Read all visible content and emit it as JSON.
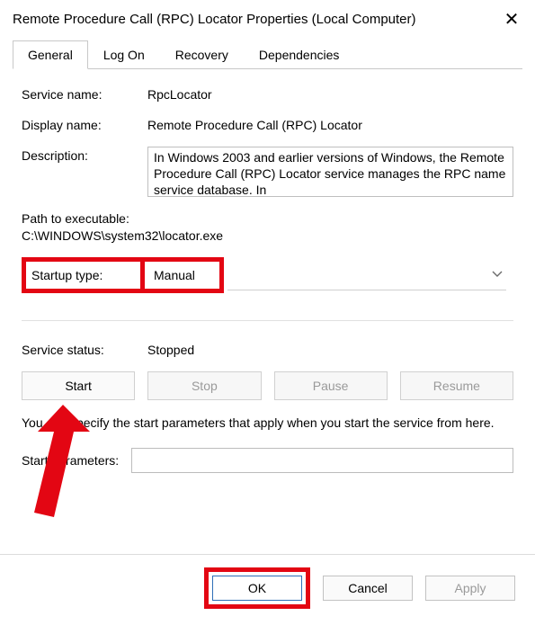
{
  "title": "Remote Procedure Call (RPC) Locator Properties (Local Computer)",
  "tabs": {
    "general": "General",
    "logon": "Log On",
    "recovery": "Recovery",
    "dependencies": "Dependencies"
  },
  "labels": {
    "service_name": "Service name:",
    "display_name": "Display name:",
    "description": "Description:",
    "path_to_exe": "Path to executable:",
    "startup_type": "Startup type:",
    "service_status": "Service status:",
    "start_params": "Start parameters:"
  },
  "values": {
    "service_name": "RpcLocator",
    "display_name": "Remote Procedure Call (RPC) Locator",
    "description": "In Windows 2003 and earlier versions of Windows, the Remote Procedure Call (RPC) Locator service manages the RPC name service database. In",
    "path": "C:\\WINDOWS\\system32\\locator.exe",
    "startup_type": "Manual",
    "service_status": "Stopped",
    "start_params": ""
  },
  "buttons": {
    "start": "Start",
    "stop": "Stop",
    "pause": "Pause",
    "resume": "Resume",
    "ok": "OK",
    "cancel": "Cancel",
    "apply": "Apply"
  },
  "hint": "You can specify the start parameters that apply when you start the service from here.",
  "highlight_color": "#e30613"
}
